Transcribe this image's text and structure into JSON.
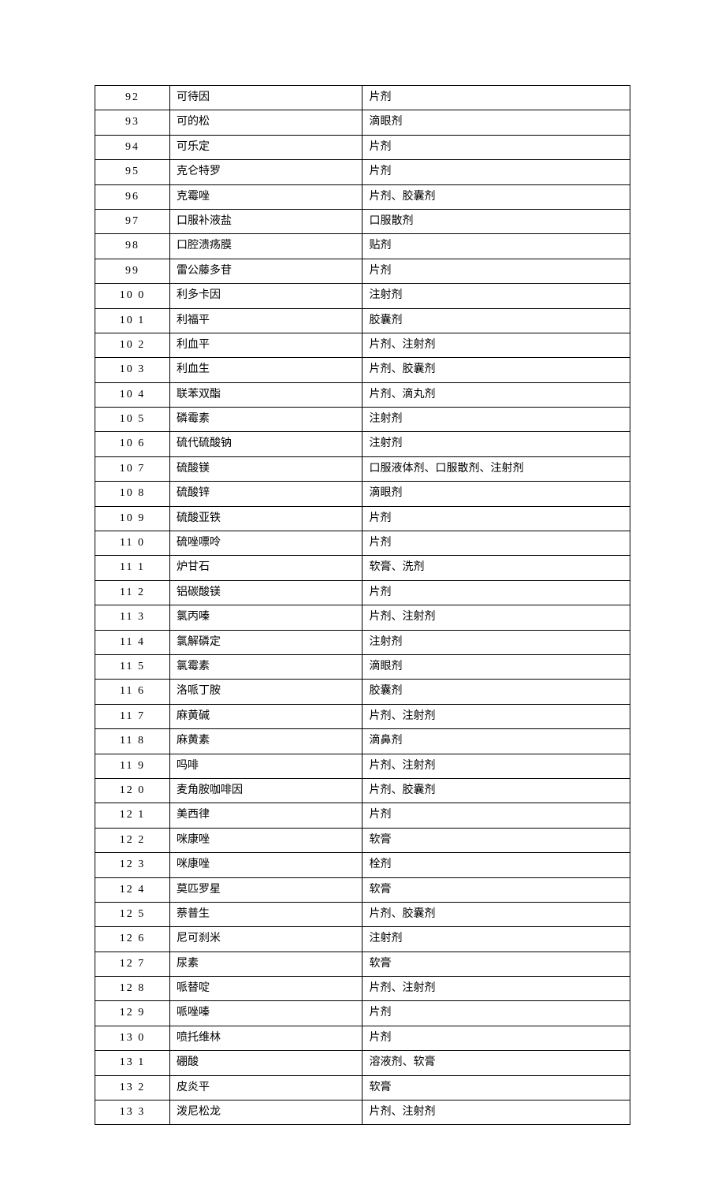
{
  "rows": [
    {
      "num": "92",
      "name": "可待因",
      "form": "片剂"
    },
    {
      "num": "93",
      "name": "可的松",
      "form": "滴眼剂"
    },
    {
      "num": "94",
      "name": "可乐定",
      "form": "片剂"
    },
    {
      "num": "95",
      "name": "克仑特罗",
      "form": "片剂"
    },
    {
      "num": "96",
      "name": "克霉唑",
      "form": "片剂、胶囊剂"
    },
    {
      "num": "97",
      "name": "口服补液盐",
      "form": "口服散剂"
    },
    {
      "num": "98",
      "name": "口腔溃疡膜",
      "form": "贴剂"
    },
    {
      "num": "99",
      "name": "雷公藤多苷",
      "form": "片剂"
    },
    {
      "num": "10 0",
      "name": "利多卡因",
      "form": "注射剂"
    },
    {
      "num": "10 1",
      "name": "利福平",
      "form": "胶囊剂"
    },
    {
      "num": "10 2",
      "name": "利血平",
      "form": "片剂、注射剂"
    },
    {
      "num": "10 3",
      "name": "利血生",
      "form": "片剂、胶囊剂"
    },
    {
      "num": "10 4",
      "name": "联苯双酯",
      "form": "片剂、滴丸剂"
    },
    {
      "num": "10 5",
      "name": "磷霉素",
      "form": "注射剂"
    },
    {
      "num": "10 6",
      "name": "硫代硫酸钠",
      "form": "注射剂"
    },
    {
      "num": "10 7",
      "name": "硫酸镁",
      "form": "口服液体剂、口服散剂、注射剂"
    },
    {
      "num": "10 8",
      "name": "硫酸锌",
      "form": "滴眼剂"
    },
    {
      "num": "10 9",
      "name": "硫酸亚铁",
      "form": "片剂"
    },
    {
      "num": "11 0",
      "name": "硫唑嘌呤",
      "form": "片剂"
    },
    {
      "num": "11 1",
      "name": "炉甘石",
      "form": "软膏、洗剂"
    },
    {
      "num": "11 2",
      "name": "铝碳酸镁",
      "form": "片剂"
    },
    {
      "num": "11 3",
      "name": "氯丙嗪",
      "form": "片剂、注射剂"
    },
    {
      "num": "11 4",
      "name": "氯解磷定",
      "form": "注射剂"
    },
    {
      "num": "11 5",
      "name": "氯霉素",
      "form": "滴眼剂"
    },
    {
      "num": "11 6",
      "name": "洛哌丁胺",
      "form": "胶囊剂"
    },
    {
      "num": "11 7",
      "name": "麻黄碱",
      "form": "片剂、注射剂"
    },
    {
      "num": "11 8",
      "name": "麻黄素",
      "form": "滴鼻剂"
    },
    {
      "num": "11 9",
      "name": "吗啡",
      "form": "片剂、注射剂"
    },
    {
      "num": "12 0",
      "name": "麦角胺咖啡因",
      "form": "片剂、胶囊剂"
    },
    {
      "num": "12 1",
      "name": "美西律",
      "form": "片剂"
    },
    {
      "num": "12 2",
      "name": "咪康唑",
      "form": "软膏"
    },
    {
      "num": "12 3",
      "name": "咪康唑",
      "form": "栓剂"
    },
    {
      "num": "12 4",
      "name": "莫匹罗星",
      "form": "软膏"
    },
    {
      "num": "12 5",
      "name": "萘普生",
      "form": "片剂、胶囊剂"
    },
    {
      "num": "12 6",
      "name": "尼可刹米",
      "form": "注射剂"
    },
    {
      "num": "12 7",
      "name": "尿素",
      "form": "软膏"
    },
    {
      "num": "12 8",
      "name": "哌替啶",
      "form": "片剂、注射剂"
    },
    {
      "num": "12 9",
      "name": "哌唑嗪",
      "form": "片剂"
    },
    {
      "num": "13 0",
      "name": "喷托维林",
      "form": "片剂"
    },
    {
      "num": "13 1",
      "name": "硼酸",
      "form": "溶液剂、软膏"
    },
    {
      "num": "13 2",
      "name": "皮炎平",
      "form": "软膏"
    },
    {
      "num": "13 3",
      "name": "泼尼松龙",
      "form": "片剂、注射剂"
    }
  ]
}
